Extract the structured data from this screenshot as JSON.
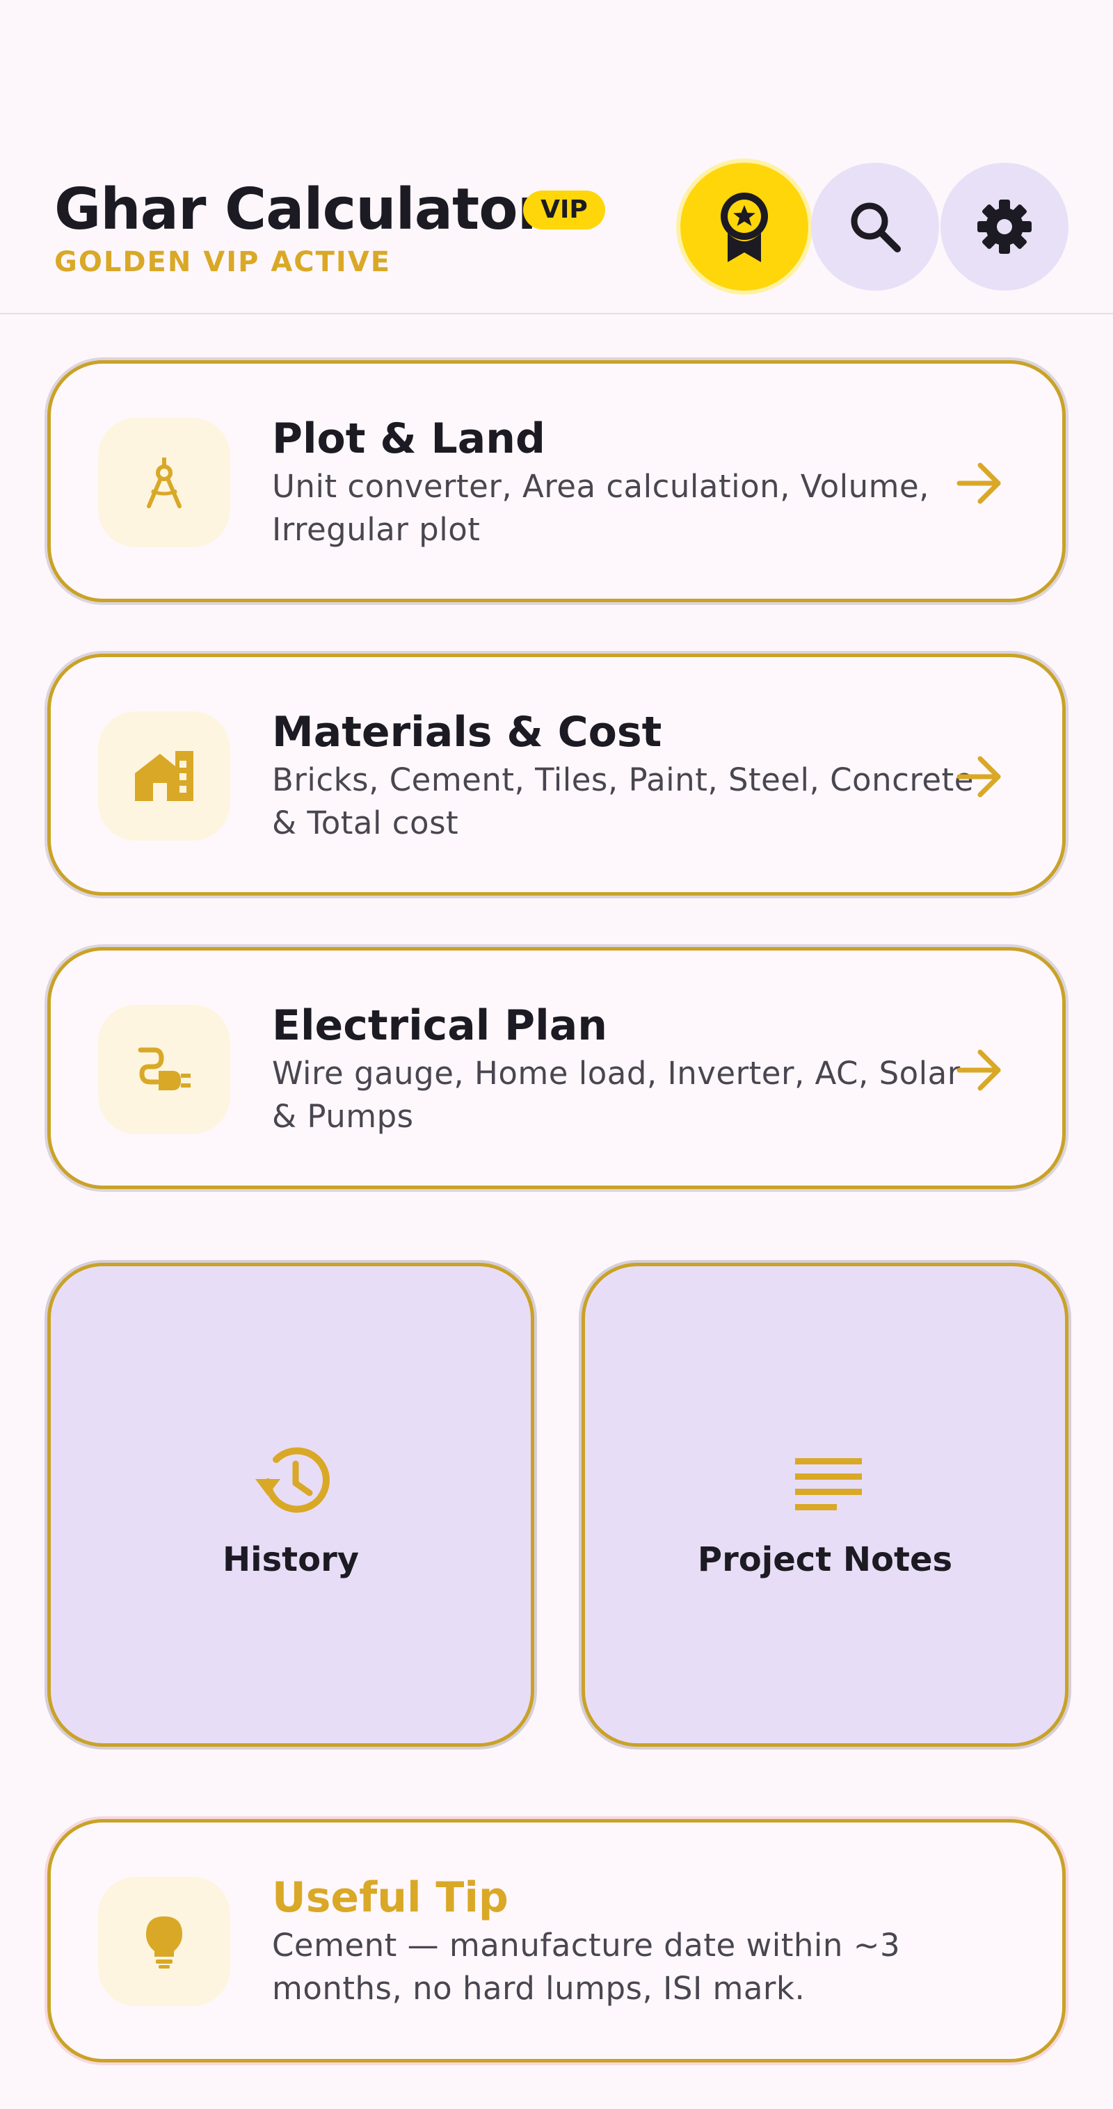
{
  "header": {
    "title": "Ghar Calculator",
    "badge": "VIP",
    "subtitle": "GOLDEN VIP ACTIVE",
    "buttons": {
      "vip": "vip-award-icon",
      "search": "search-icon",
      "settings": "gear-icon"
    }
  },
  "cards": [
    {
      "title": "Plot & Land",
      "description": "Unit converter, Area calculation, Volume, Irregular plot",
      "icon": "compass-icon"
    },
    {
      "title": "Materials & Cost",
      "description": "Bricks, Cement, Tiles, Paint, Steel, Concrete & Total cost",
      "icon": "building-icon"
    },
    {
      "title": "Electrical Plan",
      "description": "Wire gauge, Home load, Inverter, AC, Solar & Pumps",
      "icon": "plug-icon"
    }
  ],
  "tiles": [
    {
      "label": "History",
      "icon": "history-icon"
    },
    {
      "label": "Project Notes",
      "icon": "notes-icon"
    }
  ],
  "tip": {
    "title": "Useful Tip",
    "text": "Cement — manufacture date within ~3 months, no hard lumps, ISI mark.",
    "icon": "lightbulb-icon"
  },
  "colors": {
    "accent": "#D9A826",
    "vip_yellow": "#FFD60A",
    "background": "#FDF7FC",
    "tile_background": "#E8DDF6",
    "card_border": "#C9A227"
  }
}
